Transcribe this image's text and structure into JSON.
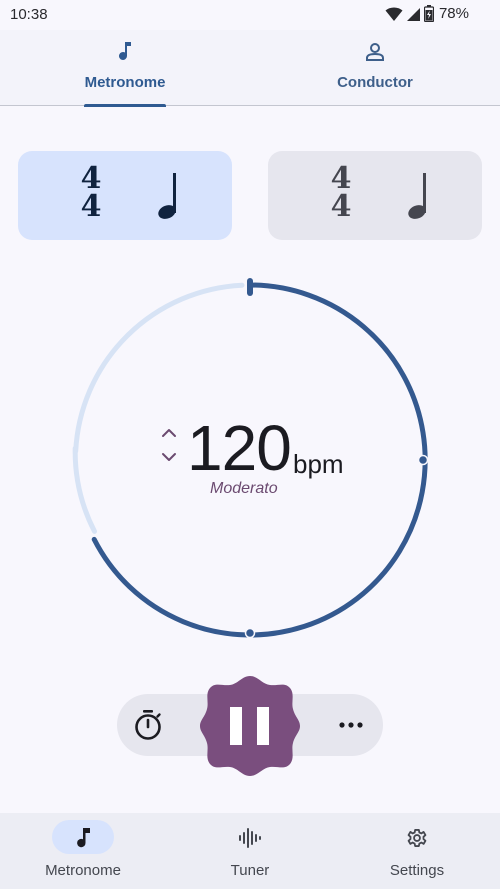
{
  "status_bar": {
    "time": "10:38",
    "battery": "78%",
    "icons": [
      "wifi-icon",
      "signal-icon",
      "battery-icon"
    ]
  },
  "top_tabs": [
    {
      "label": "Metronome",
      "icon": "music-note-icon",
      "selected": true
    },
    {
      "label": "Conductor",
      "icon": "person-icon",
      "selected": false
    }
  ],
  "beat_card": {
    "numerator": "4",
    "denominator": "4",
    "note": "quarter-note-icon"
  },
  "sub_card": {
    "numerator": "4",
    "denominator": "4",
    "note": "quarter-note-icon"
  },
  "tempo": {
    "bpm": "120",
    "unit": "bpm",
    "name": "Moderato"
  },
  "controls": {
    "timer_icon": "timer-icon",
    "play_state_icon": "pause-icon",
    "more_icon": "more-horiz-icon"
  },
  "bottom_nav": [
    {
      "label": "Metronome",
      "icon": "music-note-icon",
      "active": true
    },
    {
      "label": "Tuner",
      "icon": "waveform-icon",
      "active": false
    },
    {
      "label": "Settings",
      "icon": "gear-icon",
      "active": false
    }
  ],
  "colors": {
    "primary": "#2f5a91",
    "primary_container": "#d7e3fd",
    "accent_play": "#7a4e7e",
    "track": "#d7e3f5",
    "surface": "#f8f7fd"
  }
}
